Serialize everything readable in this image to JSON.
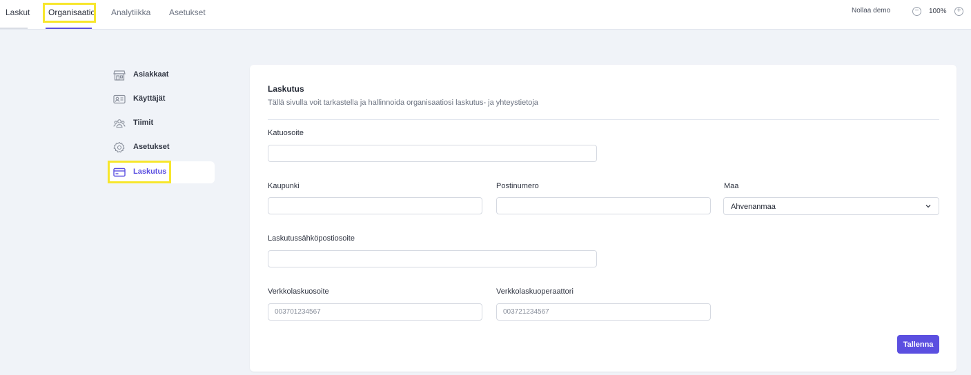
{
  "nav": {
    "tabs": [
      {
        "label": "Laskut"
      },
      {
        "label": "Organisaatio"
      },
      {
        "label": "Analytiikka"
      },
      {
        "label": "Asetukset"
      }
    ],
    "active_tab": "Organisaatio",
    "user": "Nollaa demo",
    "zoom": "100%"
  },
  "sidebar": {
    "items": [
      {
        "label": "Asiakkaat",
        "icon": "store-icon"
      },
      {
        "label": "Käyttäjät",
        "icon": "id-card-icon"
      },
      {
        "label": "Tiimit",
        "icon": "team-icon"
      },
      {
        "label": "Asetukset",
        "icon": "gear-icon"
      },
      {
        "label": "Laskutus",
        "icon": "credit-card-icon"
      }
    ],
    "active_item": "Laskutus"
  },
  "form": {
    "title": "Laskutus",
    "subtitle": "Tällä sivulla voit tarkastella ja hallinnoida organisaatiosi laskutus- ja yhteystietoja",
    "street": {
      "label": "Katuosoite",
      "value": ""
    },
    "city": {
      "label": "Kaupunki",
      "value": ""
    },
    "postal": {
      "label": "Postinumero",
      "value": ""
    },
    "country": {
      "label": "Maa",
      "value": "Ahvenanmaa"
    },
    "email": {
      "label": "Laskutussähköpostiosoite",
      "value": ""
    },
    "einvoice_address": {
      "label": "Verkkolaskuosoite",
      "placeholder": "003701234567"
    },
    "einvoice_operator": {
      "label": "Verkkolaskuoperaattori",
      "placeholder": "003721234567"
    },
    "save_label": "Tallenna"
  },
  "colors": {
    "accent": "#5b4fe0",
    "highlight": "#f7e62c",
    "background": "#f0f3f8"
  }
}
